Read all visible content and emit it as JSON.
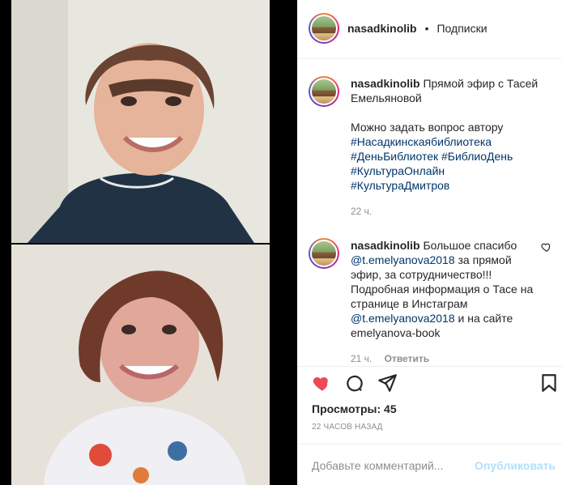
{
  "post_header": {
    "username": "nasadkinolib",
    "separator": "•",
    "follow_label": "Подписки"
  },
  "comments": [
    {
      "username": "nasadkinolib",
      "text_1": "Прямой эфир с Тасей Емельяновой",
      "text_2": "Можно задать вопрос автору",
      "tags": [
        "#Насадкинскаябиблиотека",
        "#ДеньБиблиотек",
        "#БиблиоДень",
        "#КультураОнлайн",
        "#КультураДмитров"
      ],
      "time": "22 ч."
    },
    {
      "username": "nasadkinolib",
      "text_1": "Большое спасибо",
      "mention_1": "@t.emelyanova2018",
      "text_2": "за прямой эфир, за сотрудничество!!! Подробная информация о Тасе на странице в Инстаграм",
      "mention_2": "@t.emelyanova2018",
      "text_3": "и на сайте emelyanova-book",
      "time": "21 ч.",
      "reply_label": "Ответить"
    }
  ],
  "stats": {
    "views_label": "Просмотры: 45",
    "posted_time": "22 ЧАСОВ НАЗАД"
  },
  "add_comment": {
    "placeholder": "Добавьте комментарий...",
    "publish_label": "Опубликовать"
  },
  "icons": {
    "like": "heart-filled-icon",
    "comment": "comment-icon",
    "share": "share-icon",
    "save": "bookmark-icon",
    "comment_like": "heart-outline-icon"
  },
  "colors": {
    "like_red": "#ed4956",
    "link_blue": "#003569",
    "publish_disabled": "#b2dffc"
  }
}
